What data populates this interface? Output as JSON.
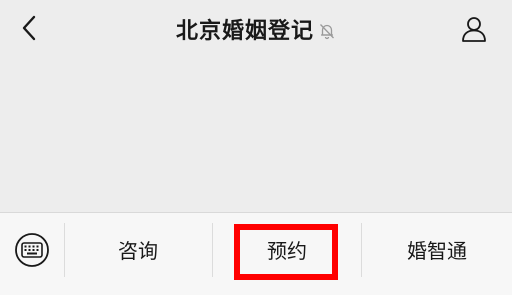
{
  "header": {
    "title": "北京婚姻登记",
    "back_icon": "chevron-left-icon",
    "mute_icon": "bell-off-icon",
    "profile_icon": "person-icon"
  },
  "bottom_menu": {
    "keyboard_icon": "keyboard-icon",
    "items": [
      {
        "label": "咨询"
      },
      {
        "label": "预约"
      },
      {
        "label": "婚智通"
      }
    ]
  },
  "colors": {
    "background": "#ededed",
    "bottom_bar": "#f7f7f7",
    "highlight": "#ff0000",
    "text": "#191919"
  }
}
